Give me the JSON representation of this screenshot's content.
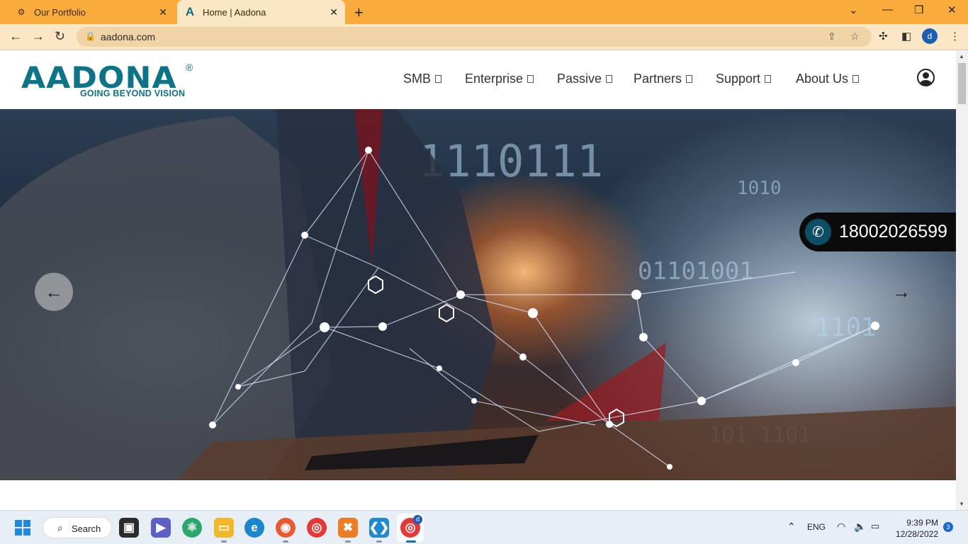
{
  "browser": {
    "tabs": [
      {
        "title": "Our Portfolio",
        "icon": "portfolio-favicon",
        "active": false
      },
      {
        "title": "Home | Aadona",
        "icon": "aadona-favicon",
        "active": true
      }
    ],
    "new_tab_symbol": "+",
    "url": "aadona.com",
    "profile_initial": "d"
  },
  "site": {
    "logo": {
      "word": "AADONA",
      "registered": "®",
      "tagline": "GOING BEYOND VISION"
    },
    "nav": [
      {
        "label": "SMB"
      },
      {
        "label": "Enterprise"
      },
      {
        "label": "Passive"
      },
      {
        "label": "Partners"
      },
      {
        "label": "Support"
      },
      {
        "label": "About Us"
      }
    ],
    "phone": "18002026599"
  },
  "taskbar": {
    "search_label": "Search",
    "language": "ENG",
    "time": "9:39 PM",
    "date": "12/28/2022",
    "notification_count": "3",
    "chrome_badge": "d"
  },
  "colors": {
    "tabbar": "#f9ac3b",
    "toolbar": "#fbe7c6",
    "brand": "#0c7488"
  }
}
